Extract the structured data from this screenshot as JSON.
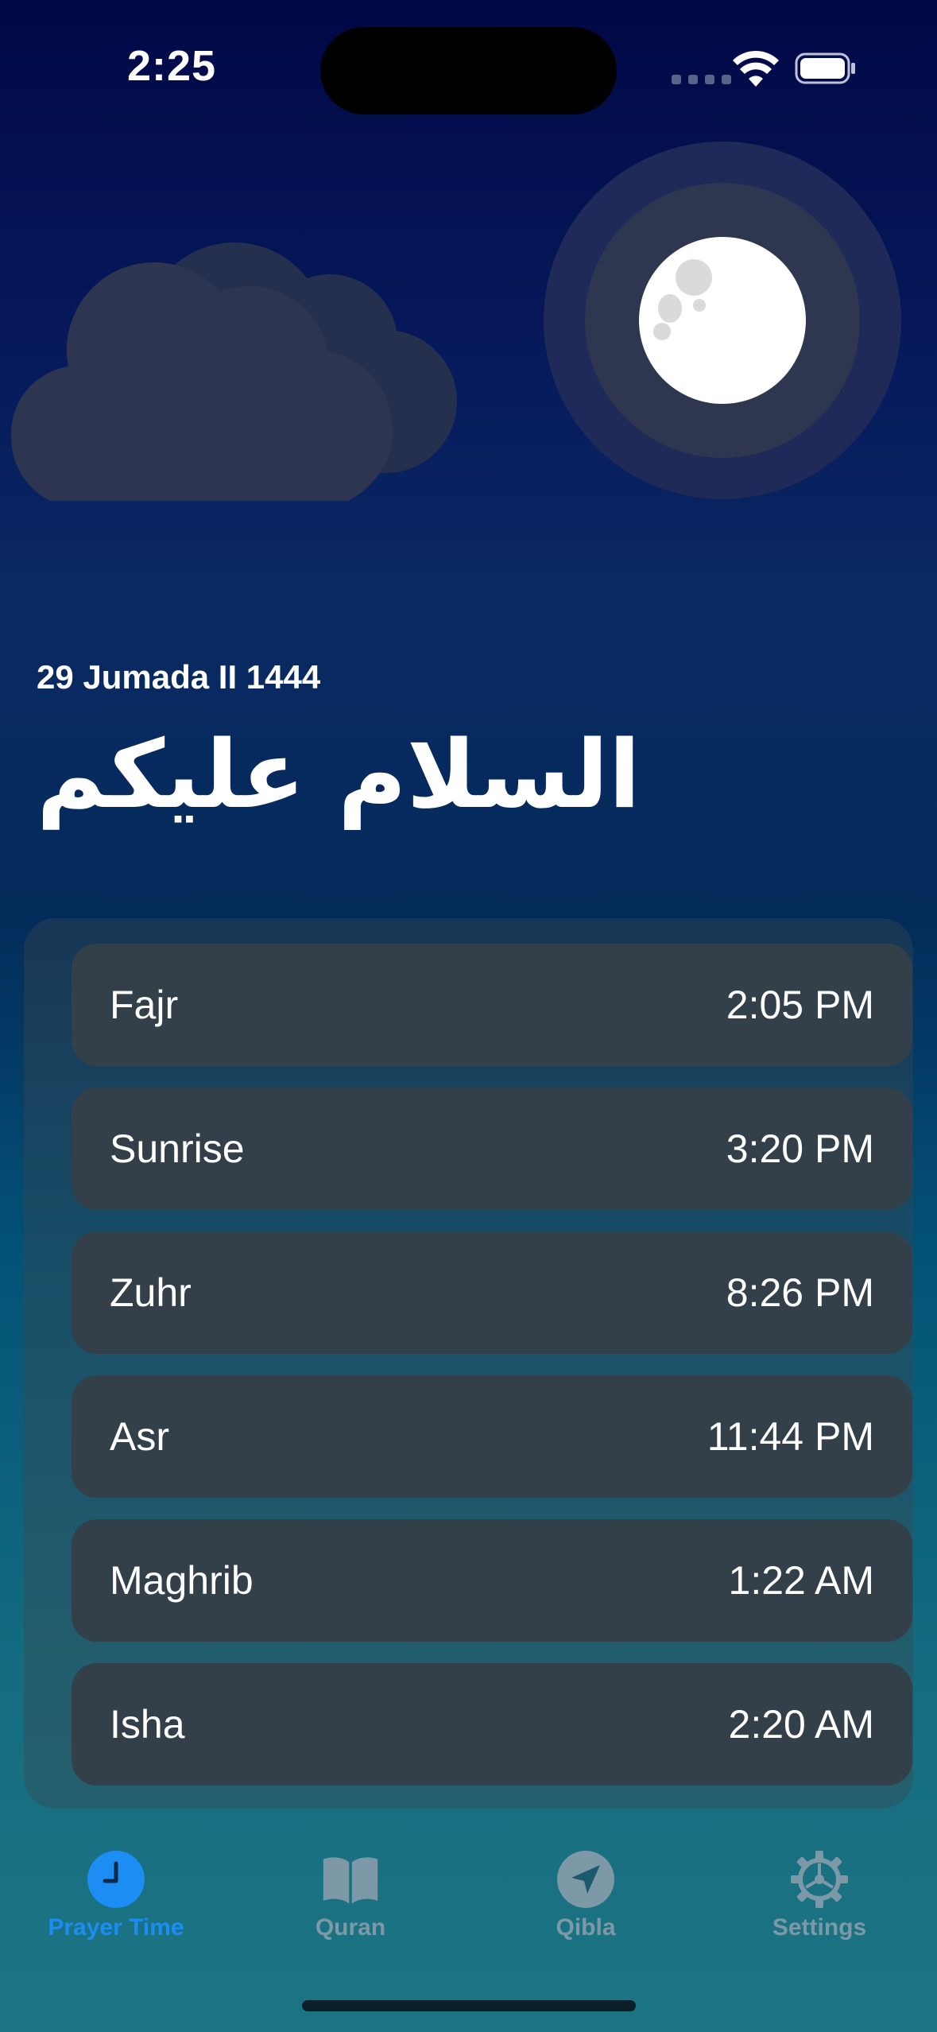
{
  "status_bar": {
    "time": "2:25"
  },
  "header": {
    "hijri_date": "29 Jumada II 1444",
    "greeting": "السلام عليكم"
  },
  "prayers": [
    {
      "name": "Fajr",
      "time": "2:05 PM"
    },
    {
      "name": "Sunrise",
      "time": "3:20 PM"
    },
    {
      "name": "Zuhr",
      "time": "8:26 PM"
    },
    {
      "name": "Asr",
      "time": "11:44 PM"
    },
    {
      "name": "Maghrib",
      "time": "1:22 AM"
    },
    {
      "name": "Isha",
      "time": "2:20 AM"
    }
  ],
  "tabs": [
    {
      "label": "Prayer Time",
      "icon": "clock-icon",
      "active": true
    },
    {
      "label": "Quran",
      "icon": "book-icon",
      "active": false
    },
    {
      "label": "Qibla",
      "icon": "location-arrow-icon",
      "active": false
    },
    {
      "label": "Settings",
      "icon": "gear-icon",
      "active": false
    }
  ],
  "colors": {
    "accent": "#1c8df2",
    "inactive_tab": "#7d98a6",
    "row_background": "#334049"
  }
}
